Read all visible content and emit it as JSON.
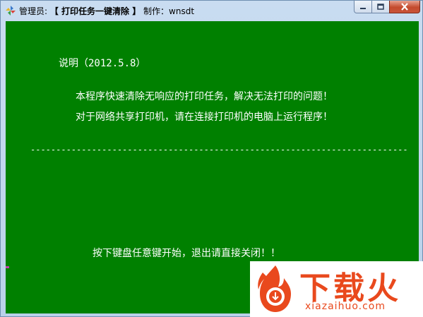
{
  "window": {
    "title_prefix": "管理员: ",
    "title_main": "【 打印任务一键清除 】",
    "title_suffix": " 制作：wnsdt",
    "minimize_glyph": "─",
    "maximize_glyph": "□",
    "close_glyph": "✕"
  },
  "console": {
    "background": "#008000",
    "text_color": "#ffffff",
    "heading": "说明（2012.5.8）",
    "line1": "本程序快速清除无响应的打印任务，解决无法打印的问题！",
    "line2": "对于网络共享打印机，请在连接打印机的电脑上运行程序！",
    "separator": "--------------------------------------------------------------------------",
    "prompt": "按下键盘任意键开始，退出请直接关闭！！"
  },
  "watermark": {
    "brand": "下载火",
    "url": "xiazaihuo.com",
    "color": "#e9491d"
  }
}
